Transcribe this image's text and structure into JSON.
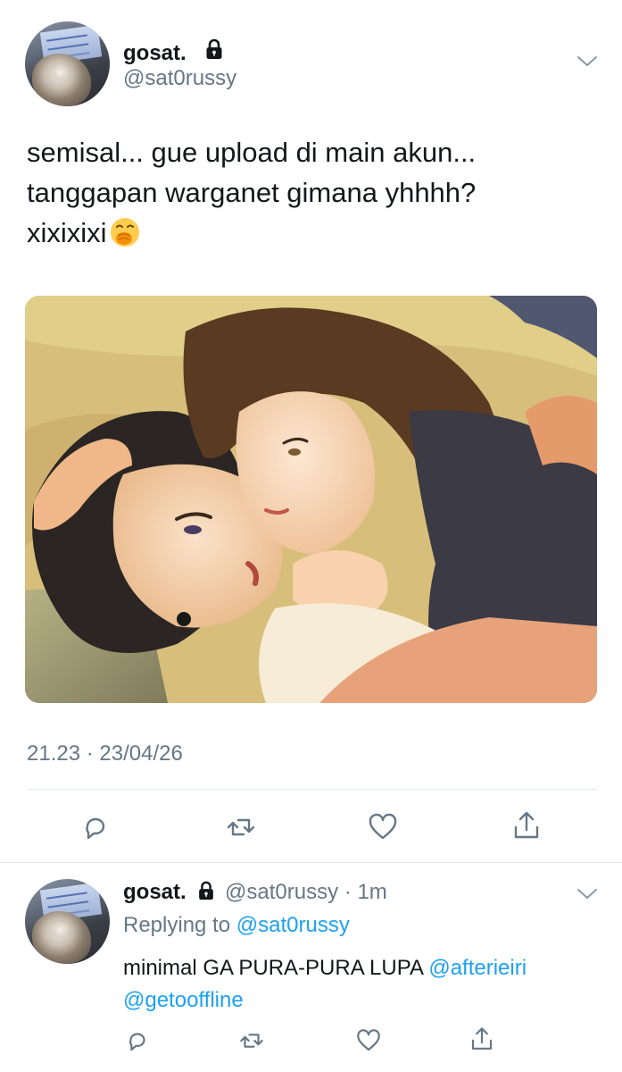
{
  "tweet": {
    "display_name": "gosat.",
    "handle": "@sat0russy",
    "text_lines": [
      "semisal... gue upload di main akun...",
      "tanggapan warganet gimana yhhhh?",
      "xixixixi"
    ],
    "emoji": "face-with-hand-over-mouth-icon",
    "timestamp": "21.23 · 23/04/26"
  },
  "reply": {
    "display_name": "gosat.",
    "handle": "@sat0russy",
    "time": "· 1m",
    "replying_prefix": "Replying to ",
    "replying_handle": "@sat0russy",
    "text": "minimal GA PURA-PURA LUPA ",
    "mention_1": "@afterieiri",
    "mention_2": "@getooffline"
  },
  "colors": {
    "text": "#14171a",
    "muted": "#657786",
    "link": "#1da1f2",
    "divider": "#e1e8ed"
  },
  "icons": [
    "lock-icon",
    "chevron-down-icon",
    "reply-icon",
    "retweet-icon",
    "like-icon",
    "share-icon"
  ]
}
